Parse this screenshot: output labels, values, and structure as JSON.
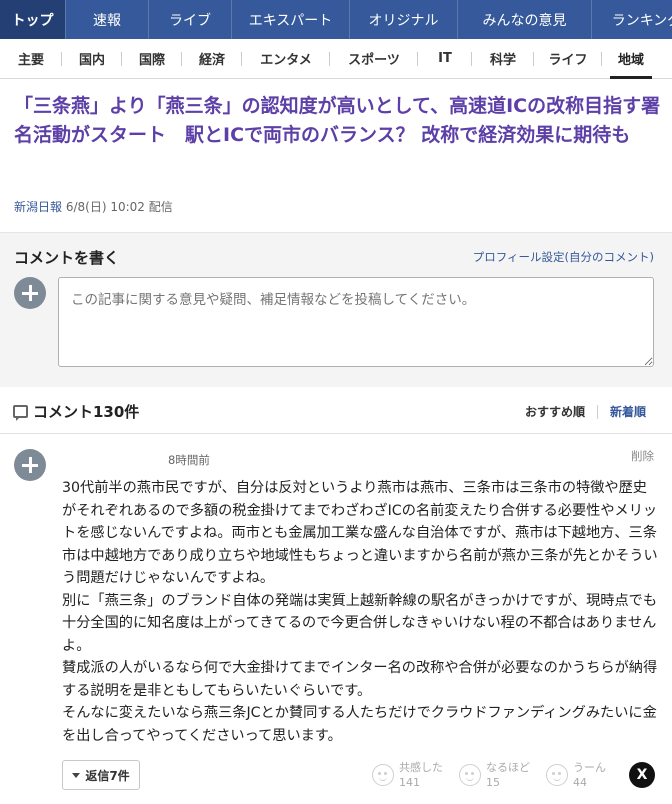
{
  "top_nav": {
    "items": [
      {
        "label": "トップ",
        "active": true
      },
      {
        "label": "速報"
      },
      {
        "label": "ライブ"
      },
      {
        "label": "エキスパート"
      },
      {
        "label": "オリジナル"
      },
      {
        "label": "みんなの意見"
      },
      {
        "label": "ランキング"
      }
    ]
  },
  "sub_nav": {
    "items": [
      {
        "label": "主要"
      },
      {
        "label": "国内"
      },
      {
        "label": "国際"
      },
      {
        "label": "経済"
      },
      {
        "label": "エンタメ"
      },
      {
        "label": "スポーツ"
      },
      {
        "label": "IT"
      },
      {
        "label": "科学"
      },
      {
        "label": "ライフ"
      },
      {
        "label": "地域",
        "active": true
      }
    ]
  },
  "article": {
    "title": "「三条燕」より「燕三条」の認知度が高いとして、高速道ICの改称目指す署名活動がスタート　駅とICで両市のバランス？ 改称で経済効果に期待も",
    "source": "新潟日報",
    "date": "6/8(日) 10:02",
    "date_suffix": "配信"
  },
  "comment_form": {
    "title": "コメントを書く",
    "profile_link": "プロフィール設定(自分のコメント)",
    "placeholder": "この記事に関する意見や疑問、補足情報などを投稿してください。"
  },
  "comments_header": {
    "count_label": "コメント130件",
    "sort_recommended": "おすすめ順",
    "sort_newest": "新着順"
  },
  "comment": {
    "time": "8時間前",
    "delete_label": "削除",
    "paragraphs": [
      "30代前半の燕市民ですが、自分は反対というより燕市は燕市、三条市は三条市の特徴や歴史がそれぞれあるので多額の税金掛けてまでわざわざICの名前変えたり合併する必要性やメリットを感じないんですよね。両市とも金属加工業な盛んな自治体ですが、燕市は下越地方、三条市は中越地方であり成り立ちや地域性もちょっと違いますから名前が燕か三条が先とかそういう問題だけじゃないんですよね。",
      "別に「燕三条」のブランド自体の発端は実質上越新幹線の駅名がきっかけですが、現時点でも十分全国的に知名度は上がってきてるので今更合併しなきゃいけない程の不都合はありませんよ。",
      "賛成派の人がいるなら何で大金掛けてまでインター名の改称や合併が必要なのかうちらが納得する説明を是非ともしてもらいたいぐらいです。",
      "そんなに変えたいなら燕三条JCとか賛同する人たちだけでクラウドファンディングみたいに金を出し合ってやってくださいって思います。"
    ],
    "reply_label": "返信7件",
    "reactions": [
      {
        "label": "共感した",
        "count": "141"
      },
      {
        "label": "なるほど",
        "count": "15"
      },
      {
        "label": "うーん",
        "count": "44"
      }
    ],
    "share_label": "X"
  }
}
